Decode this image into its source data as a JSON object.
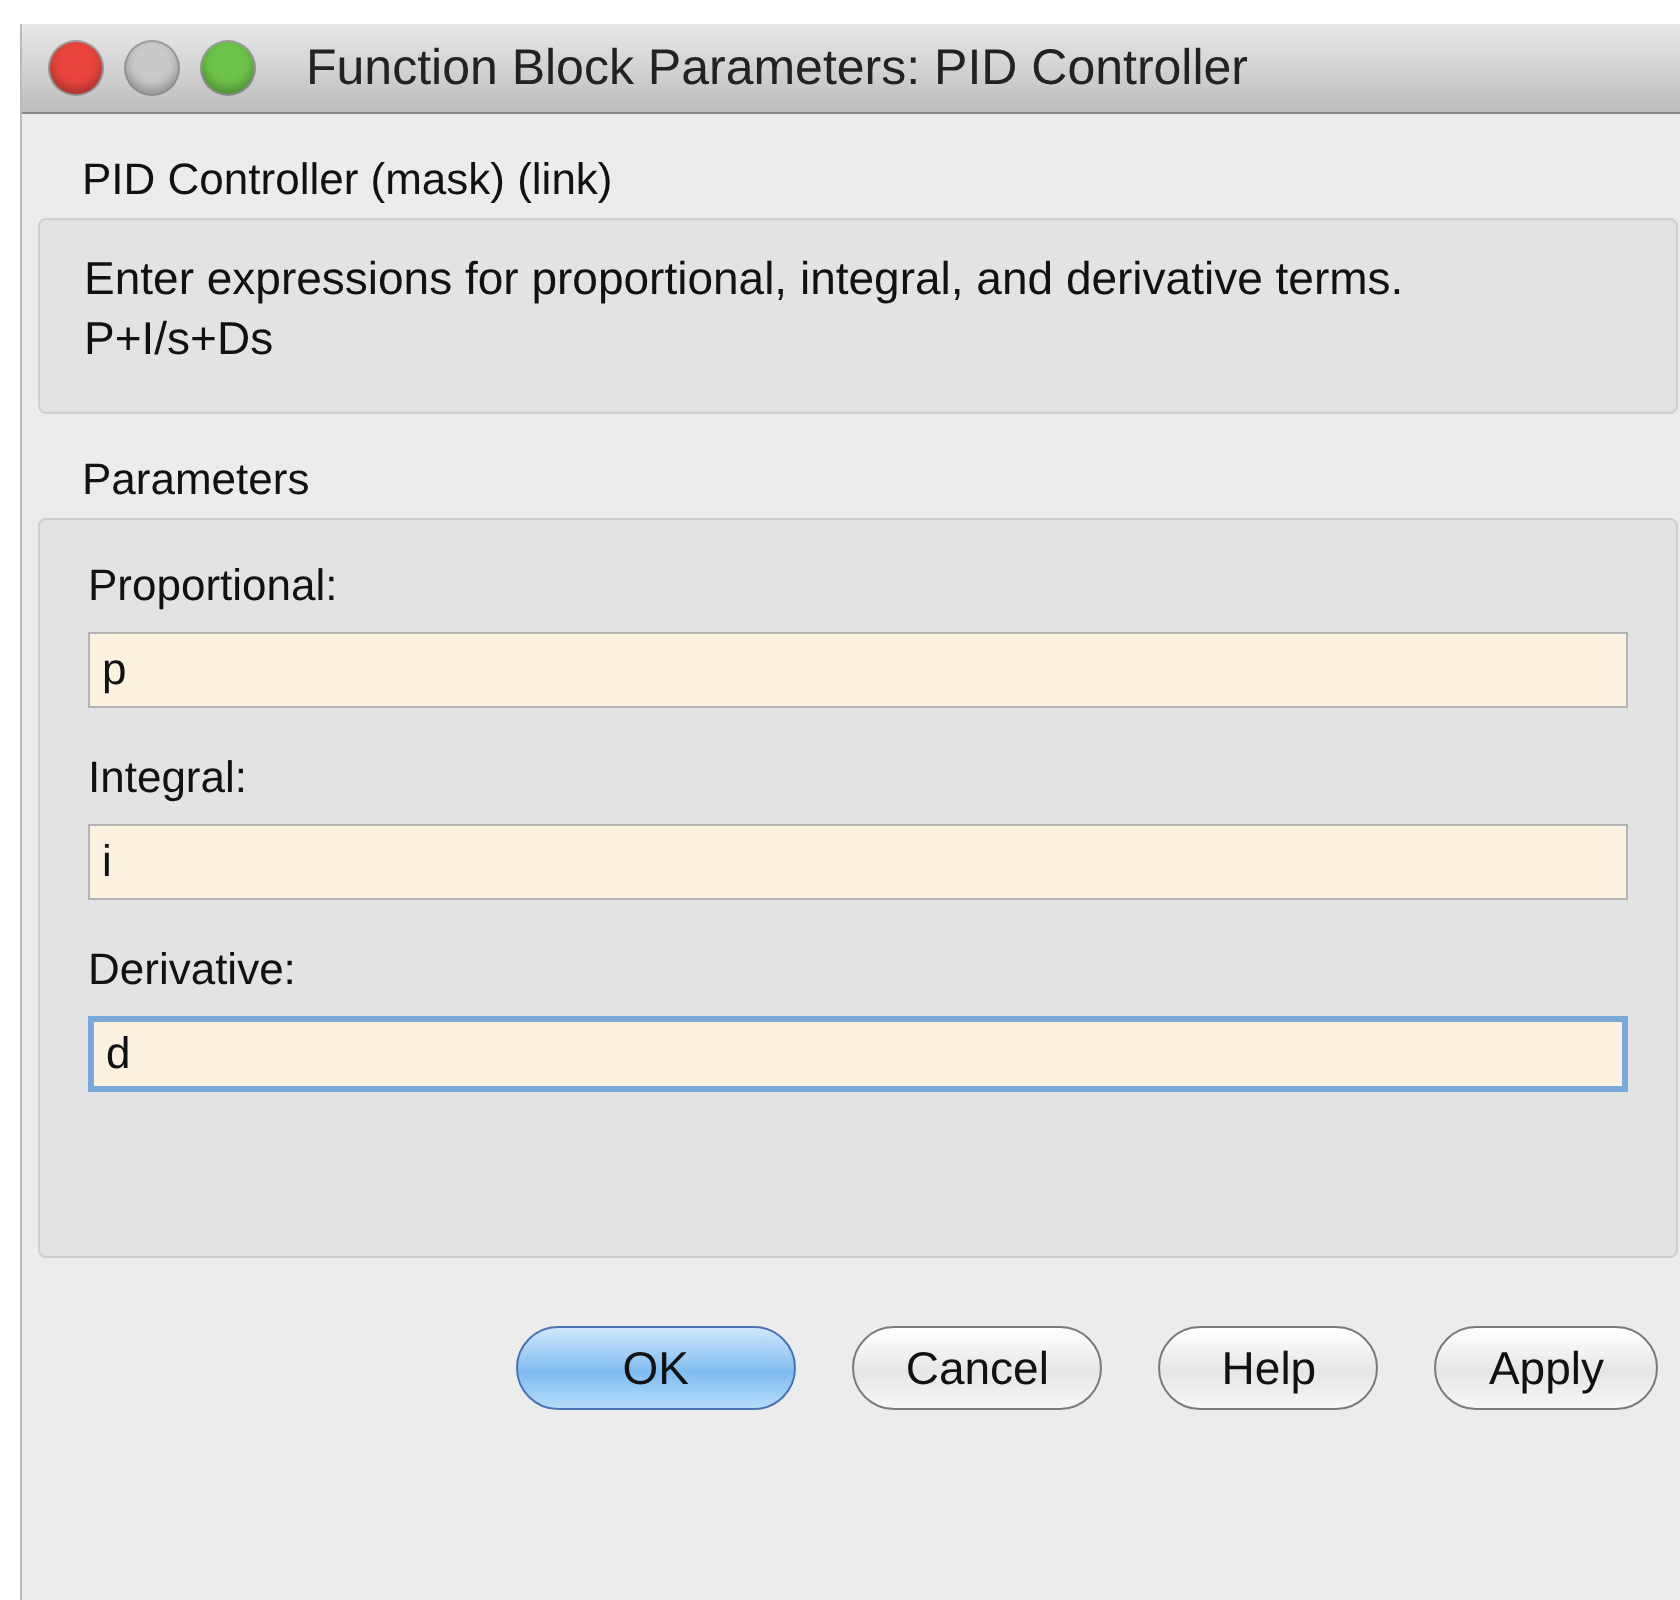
{
  "window": {
    "title": "Function Block Parameters: PID Controller",
    "controls": [
      {
        "kind": "close"
      },
      {
        "kind": "minimize"
      },
      {
        "kind": "zoom"
      }
    ]
  },
  "block_title": "PID Controller (mask) (link)",
  "description": {
    "text": "Enter expressions for proportional, integral, and derivative terms.",
    "formula": "P+I/s+Ds"
  },
  "parameters": {
    "title": "Parameters",
    "fields": [
      {
        "label": "Proportional:",
        "value": "p",
        "focused": false
      },
      {
        "label": "Integral:",
        "value": "i",
        "focused": false
      },
      {
        "label": "Derivative:",
        "value": "d",
        "focused": true
      }
    ]
  },
  "buttons": [
    {
      "label": "OK",
      "default": true
    },
    {
      "label": "Cancel",
      "default": false
    },
    {
      "label": "Help",
      "default": false
    },
    {
      "label": "Apply",
      "default": false
    }
  ]
}
